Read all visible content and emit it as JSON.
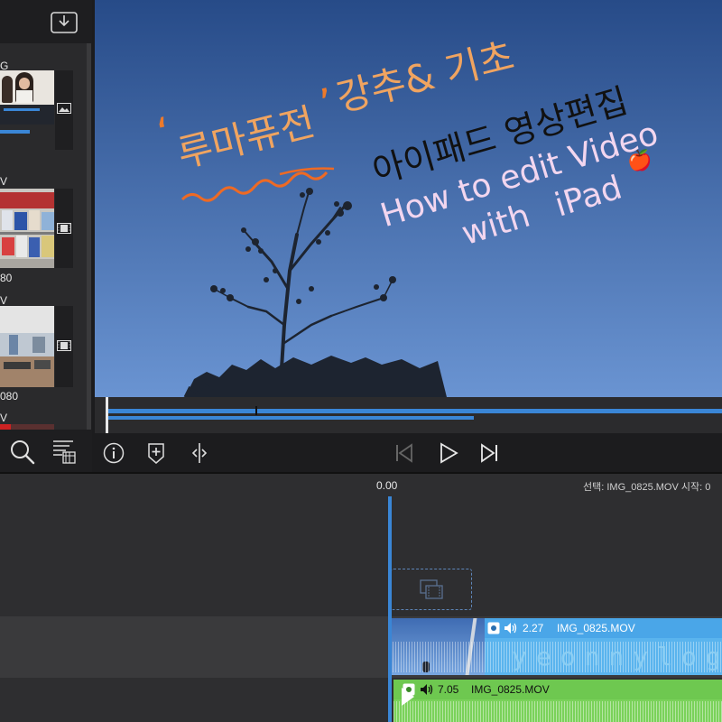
{
  "media_browser": {
    "items": [
      {
        "name": "G",
        "type": "image"
      },
      {
        "name": "V",
        "resolution": "80",
        "type": "video"
      },
      {
        "name": "V",
        "resolution": "080",
        "type": "video"
      },
      {
        "name": "V",
        "type": "video"
      }
    ]
  },
  "viewer": {
    "overlay_title_quote_open": "‘",
    "overlay_title_main": "루마퓨전",
    "overlay_title_quote_close": "’",
    "overlay_title_rest": "강추& 기초",
    "overlay_line_ko": "아이패드 영상편집",
    "overlay_line_en1": "How to edit Video",
    "overlay_line_en2": "with iPad",
    "apple_emoji": "🍎"
  },
  "timeline": {
    "timecode": "0.00",
    "selection_info": "선택: IMG_0825.MOV 시작: 0",
    "clips": [
      {
        "duration": "2.27",
        "name": "IMG_0825.MOV",
        "watermark": "yeonnylog"
      },
      {
        "duration": "7.05",
        "name": "IMG_0825.MOV"
      }
    ]
  },
  "colors": {
    "accent_blue": "#3a86d6",
    "clip_blue": "#5ab4ee",
    "clip_green": "#7ad25a",
    "sky_top": "#274b88",
    "sky_bottom": "#6a94d2"
  },
  "icons": [
    "export-icon",
    "image-type-icon",
    "video-type-icon",
    "search-icon",
    "library-sort-icon",
    "info-icon",
    "add-marker-icon",
    "split-icon",
    "skip-back-icon",
    "play-icon",
    "skip-forward-icon",
    "clip-placeholder-icon",
    "camera-icon",
    "speaker-icon"
  ]
}
